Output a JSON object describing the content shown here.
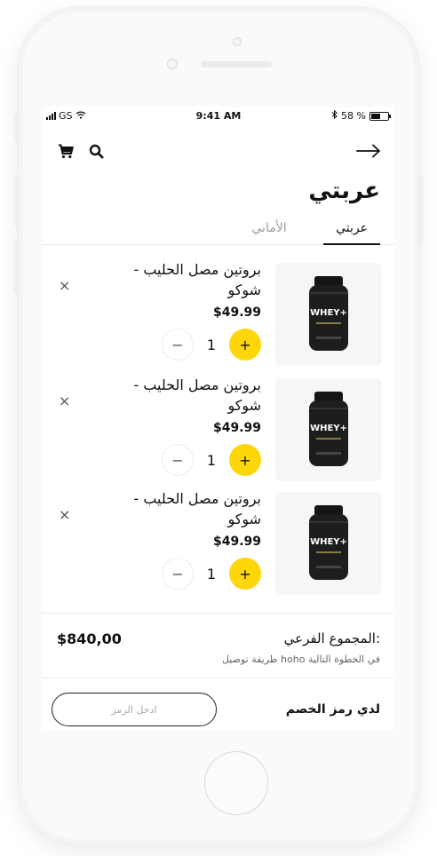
{
  "status_bar": {
    "carrier": "GS",
    "time": "9:41 AM",
    "battery_percent": "58 %",
    "battery_level": 0.58
  },
  "header": {
    "title": "عربتي"
  },
  "tabs": [
    {
      "label": "عربتي",
      "active": true
    },
    {
      "label": "الأماني",
      "active": false
    }
  ],
  "cart": {
    "items": [
      {
        "name": "بروتين مصل الحليب - شوكو",
        "price": "$49.99",
        "quantity": "1",
        "image_label": "WHEY+"
      },
      {
        "name": "بروتين مصل الحليب - شوكو",
        "price": "$49.99",
        "quantity": "1",
        "image_label": "WHEY+"
      },
      {
        "name": "بروتين مصل الحليب - شوكو",
        "price": "$49.99",
        "quantity": "1",
        "image_label": "WHEY+"
      }
    ],
    "minus_label": "−",
    "plus_label": "+",
    "remove_label": "×"
  },
  "summary": {
    "subtotal_label": ":المجموع الفرعي",
    "subtotal_value": "$840,00",
    "shipping_note": "في الخطوة التالية hoho طريقة توصيل"
  },
  "discount": {
    "label": "لدي رمز الخصم",
    "placeholder": "ادخل الرمز"
  },
  "colors": {
    "accent": "#ffd60a",
    "text": "#111111"
  }
}
